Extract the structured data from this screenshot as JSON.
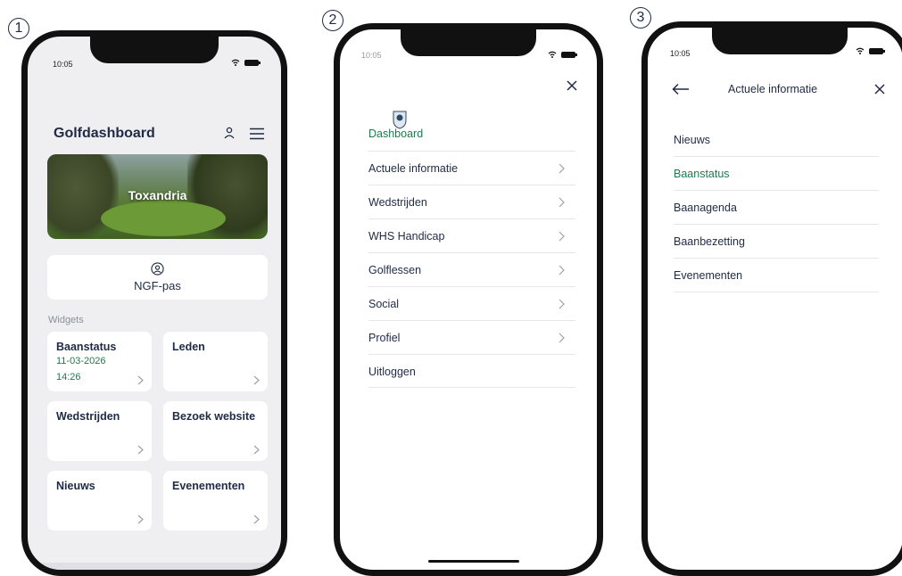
{
  "steps": [
    "1",
    "2",
    "3"
  ],
  "colors": {
    "accent_green": "#1e7a4e",
    "text_navy": "#1f2a44",
    "background_gray": "#efeff2",
    "frame": "#111111"
  },
  "screen1": {
    "status_time": "10:05",
    "title": "Golfdashboard",
    "hero_label": "Toxandria",
    "ngf_label": "NGF-pas",
    "widgets_label": "Widgets",
    "widgets": [
      {
        "title": "Baanstatus",
        "date": "11-03-2026",
        "time": "14:26"
      },
      {
        "title": "Leden"
      },
      {
        "title": "Wedstrijden"
      },
      {
        "title": "Bezoek website"
      },
      {
        "title": "Nieuws"
      },
      {
        "title": "Evenementen"
      }
    ],
    "icons": [
      "user-icon",
      "menu-icon",
      "id-card-icon",
      "chevron-right-icon"
    ]
  },
  "screen2": {
    "status_time": "10:05",
    "active_item": "Dashboard",
    "menu": [
      {
        "label": "Actuele informatie",
        "has_chevron": true
      },
      {
        "label": "Wedstrijden",
        "has_chevron": true
      },
      {
        "label": "WHS Handicap",
        "has_chevron": true
      },
      {
        "label": "Golflessen",
        "has_chevron": true
      },
      {
        "label": "Social",
        "has_chevron": true
      },
      {
        "label": "Profiel",
        "has_chevron": true
      },
      {
        "label": "Uitloggen",
        "has_chevron": false
      }
    ],
    "icons": [
      "close-icon",
      "club-logo-icon",
      "chevron-right-icon"
    ]
  },
  "screen3": {
    "status_time": "10:05",
    "title": "Actuele informatie",
    "items": [
      {
        "label": "Nieuws",
        "active": false
      },
      {
        "label": "Baanstatus",
        "active": true
      },
      {
        "label": "Baanagenda",
        "active": false
      },
      {
        "label": "Baanbezetting",
        "active": false
      },
      {
        "label": "Evenementen",
        "active": false
      }
    ],
    "icons": [
      "back-arrow-icon",
      "close-icon"
    ]
  }
}
